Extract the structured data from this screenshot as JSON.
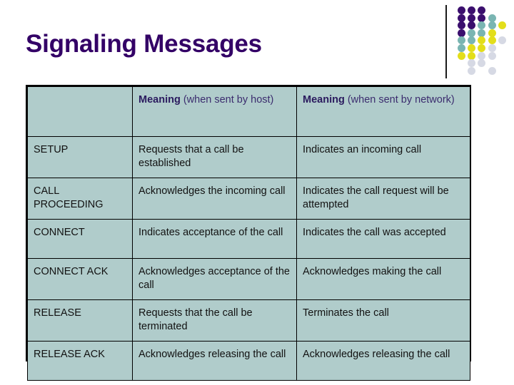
{
  "slide": {
    "title": "Signaling Messages",
    "title_color": "#330066",
    "background": "#ffffff"
  },
  "logo": {
    "name": "decorative-dot-grid",
    "rule_color": "#1a1a1a",
    "palette": {
      "purple": "#3b0f6e",
      "teal": "#7ab5b2",
      "yellow": "#e3de1a",
      "light": "#d6d9e4"
    },
    "grid": [
      [
        "purple",
        "purple",
        "purple",
        null,
        null
      ],
      [
        "purple",
        "purple",
        "purple",
        "teal",
        null
      ],
      [
        "purple",
        "purple",
        "teal",
        "teal",
        "yellow"
      ],
      [
        "purple",
        "teal",
        "teal",
        "yellow",
        null
      ],
      [
        "teal",
        "teal",
        "yellow",
        "yellow",
        "light"
      ],
      [
        "teal",
        "yellow",
        "yellow",
        "light",
        null
      ],
      [
        "yellow",
        "yellow",
        "light",
        "light",
        null
      ],
      [
        null,
        "light",
        "light",
        null,
        null
      ],
      [
        null,
        "light",
        null,
        "light",
        null
      ]
    ]
  },
  "table": {
    "name": "signaling-messages-table",
    "cell_background": "#b0cccb",
    "border_color": "#000000",
    "headers": {
      "message": "",
      "host_strong": "Meaning",
      "host_light": " (when sent by host)",
      "network_strong": "Meaning",
      "network_light": " (when sent by network)"
    },
    "rows": [
      {
        "message": "SETUP",
        "host": "Requests that a call be established",
        "network": "Indicates an incoming call"
      },
      {
        "message": "CALL PROCEEDING",
        "host": "Acknowledges the incoming call",
        "network": "Indicates the call request will be attempted"
      },
      {
        "message": "CONNECT",
        "host": "Indicates acceptance of the call",
        "network": "Indicates the call was accepted"
      },
      {
        "message": "CONNECT ACK",
        "host": "Acknowledges acceptance of the call",
        "network": "Acknowledges making the call"
      },
      {
        "message": "RELEASE",
        "host": "Requests that the call be terminated",
        "network": "Terminates the call"
      },
      {
        "message": "RELEASE ACK",
        "host": "Acknowledges releasing the call",
        "network": "Acknowledges releasing the call"
      }
    ]
  }
}
